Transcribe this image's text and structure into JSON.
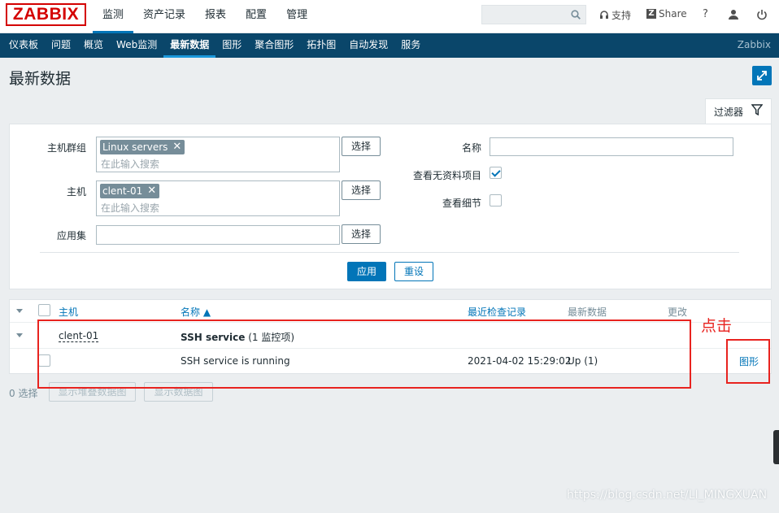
{
  "header": {
    "logo": "ZABBIX",
    "menu": [
      "监测",
      "资产记录",
      "报表",
      "配置",
      "管理"
    ],
    "support": "支持",
    "share": "Share",
    "help": "?"
  },
  "submenu": {
    "items": [
      "仪表板",
      "问题",
      "概览",
      "Web监测",
      "最新数据",
      "图形",
      "聚合图形",
      "拓扑图",
      "自动发现",
      "服务"
    ],
    "brand": "Zabbix"
  },
  "page": {
    "title": "最新数据"
  },
  "filter": {
    "tab_label": "过滤器",
    "host_group_label": "主机群组",
    "host_group_chip": "Linux servers",
    "host_label": "主机",
    "host_chip": "clent-01",
    "application_label": "应用集",
    "search_placeholder": "在此输入搜索",
    "select_label": "选择",
    "name_label": "名称",
    "show_without_data_label": "查看无资料项目",
    "show_details_label": "查看细节",
    "apply_label": "应用",
    "reset_label": "重设"
  },
  "table": {
    "headers": {
      "host": "主机",
      "name": "名称 ▲",
      "last_check": "最近检查记录",
      "last_value": "最新数据",
      "change": "更改"
    },
    "group_host": "clent-01",
    "app_name": "SSH service",
    "app_count": "(1 监控项)",
    "item_name": "SSH service is running",
    "item_last_check": "2021-04-02 15:29:02",
    "item_last_value": "Up (1)",
    "item_graph": "图形"
  },
  "footer": {
    "selected": "0 选择",
    "stacked_graph": "显示堆叠数据图",
    "graph": "显示数据图"
  },
  "annotation": {
    "text": "点击"
  },
  "watermark": "https://blog.csdn.net/LI_MINGXUAN",
  "colors": {
    "accent": "#0275b8",
    "submenu_bg": "#0a466a",
    "logo_red": "#d40000",
    "annotation_red": "#e8231f"
  }
}
